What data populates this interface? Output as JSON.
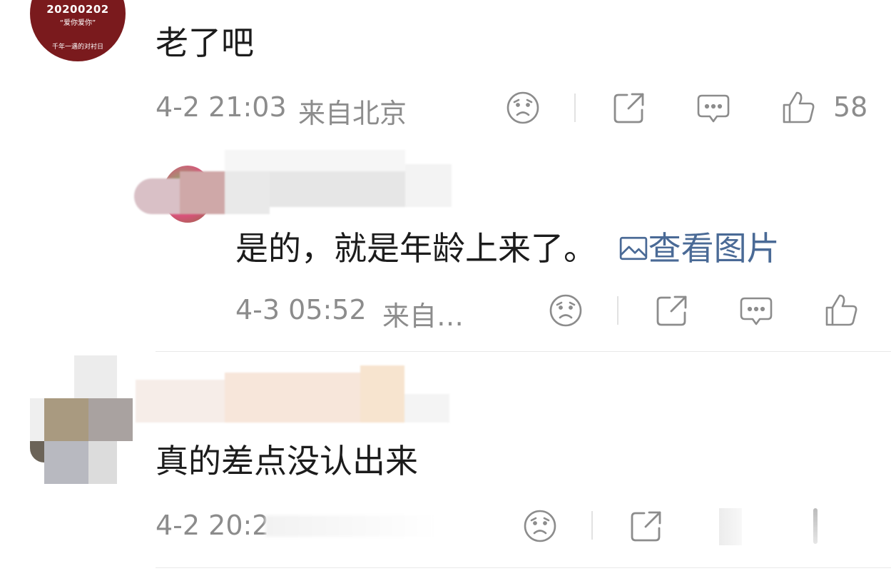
{
  "comments": [
    {
      "avatar": {
        "date": "20200202",
        "quote": "“爱你爱你”",
        "footer": "千年一遇的对衬日"
      },
      "text": "老了吧",
      "time": "4-2 21:03",
      "location": "来自北京",
      "like_count": "58"
    },
    {
      "text": "是的，就是年龄上来了。",
      "link": "查看图片",
      "time": "4-3 05:52",
      "location": "来自…"
    },
    {
      "text": "真的差点没认出来",
      "time": "4-2 20:2"
    }
  ],
  "colors": {
    "avatar_red": "#7a1a1d",
    "link_blue": "#4a6a96",
    "meta_gray": "#8c8c8c"
  },
  "icons": [
    "sad-face-icon",
    "share-icon",
    "comment-bubble-icon",
    "thumbs-up-icon",
    "picture-icon"
  ]
}
